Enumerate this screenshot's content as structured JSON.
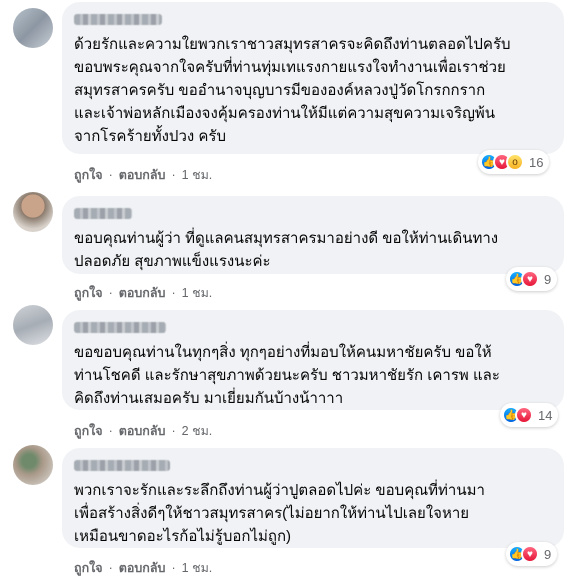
{
  "comments": [
    {
      "text": "ด้วยรักและความใยพวกเราชาวสมุทรสาครจะคิดถึงท่านตลอดไปครับ\nขอบพระคุณจากใจครับที่ท่านทุ่มเทแรงกายแรงใจทำงานเพื่อเราช่วย\nสมุทรสาครครับ ขออำนาจบุญบารมีขององค์หลวงปู่วัดโกรกกราก\nและเจ้าพ่อหลักเมืองจงคุ้มครองท่านให้มีแต่ความสุขความเจริญพ้น\nจากโรคร้ายทั้งปวง ครับ",
      "like": "ถูกใจ",
      "reply": "ตอบกลับ",
      "time": "1 ชม.",
      "reaction_icons": [
        "like-icon",
        "love-icon",
        "wow-icon"
      ],
      "reaction_count": "16"
    },
    {
      "text": "ขอบคุณท่านผู้ว่า ที่ดูแลคนสมุทรสาครมาอย่างดี ขอให้ท่านเดินทาง\nปลอดภัย สุขภาพแข็งแรงนะค่ะ",
      "like": "ถูกใจ",
      "reply": "ตอบกลับ",
      "time": "1 ชม.",
      "reaction_icons": [
        "like-icon",
        "love-icon"
      ],
      "reaction_count": "9"
    },
    {
      "text": "ขอขอบคุณท่านในทุกๆสิ่ง ทุกๆอย่างที่มอบให้คนมหาชัยครับ ขอให้\nท่านโชคดี และรักษาสุขภาพด้วยนะครับ ชาวมหาชัยรัก เคารพ และ\nคิดถึงท่านเสมอครับ มาเยี่ยมกันบ้างน้าาาา",
      "like": "ถูกใจ",
      "reply": "ตอบกลับ",
      "time": "2 ชม.",
      "reaction_icons": [
        "like-icon",
        "love-icon"
      ],
      "reaction_count": "14"
    },
    {
      "text": "พวกเราจะรักและระลึกถึงท่านผู้ว่าปูตลอดไปค่ะ ขอบคุณที่ท่านมา\nเพื่อสร้างสิ่งดีๆให้ชาวสมุทรสาคร(ไม่อยากให้ท่านไปเลยใจหาย\nเหมือนขาดอะไรก้อไม่รู้บอกไม่ถูก)",
      "like": "ถูกใจ",
      "reply": "ตอบกลับ",
      "time": "1 ชม.",
      "reaction_icons": [
        "like-icon",
        "love-icon"
      ],
      "reaction_count": "9"
    }
  ],
  "separator": "·",
  "colors": {
    "bubble": "#f0f2f5",
    "meta_text": "#65676b",
    "like_blue": "#1877f2",
    "love_red": "#f33e58"
  }
}
